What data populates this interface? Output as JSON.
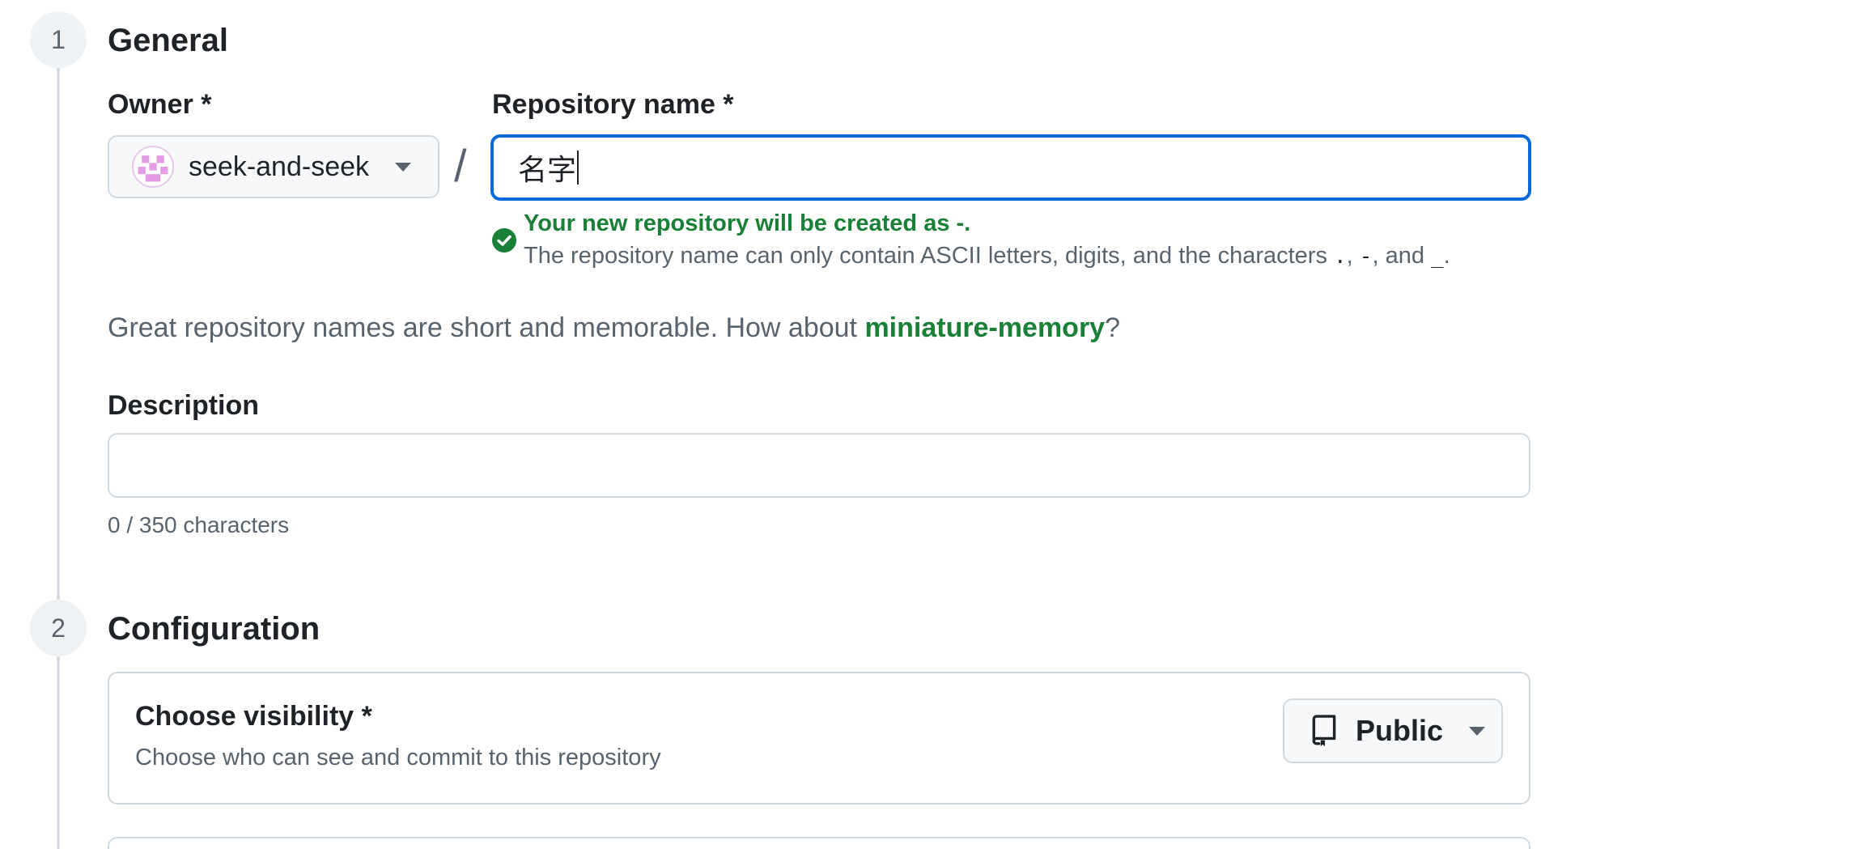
{
  "steps": [
    {
      "number": "1",
      "title": "General"
    },
    {
      "number": "2",
      "title": "Configuration"
    }
  ],
  "owner": {
    "label": "Owner *",
    "value": "seek-and-seek"
  },
  "separator": "/",
  "repo_name": {
    "label": "Repository name *",
    "value": "名字",
    "success_message": "Your new repository will be created as -.",
    "hint_prefix": "The repository name can only contain ASCII letters, digits, and the characters ",
    "hint_char_dot": ".",
    "hint_comma_1": ", ",
    "hint_char_dash": "-",
    "hint_and": ", and ",
    "hint_char_underscore": "_",
    "hint_end": "."
  },
  "suggestion": {
    "prefix": "Great repository names are short and memorable. How about ",
    "name": "miniature-memory",
    "suffix": "?"
  },
  "description": {
    "label": "Description",
    "value": "",
    "char_count": "0 / 350 characters"
  },
  "visibility": {
    "title": "Choose visibility *",
    "subtitle": "Choose who can see and commit to this repository",
    "selected": "Public"
  },
  "colors": {
    "accent": "#0969da",
    "success": "#1a7f37",
    "muted": "#59636e",
    "border": "#d1d9e0"
  }
}
